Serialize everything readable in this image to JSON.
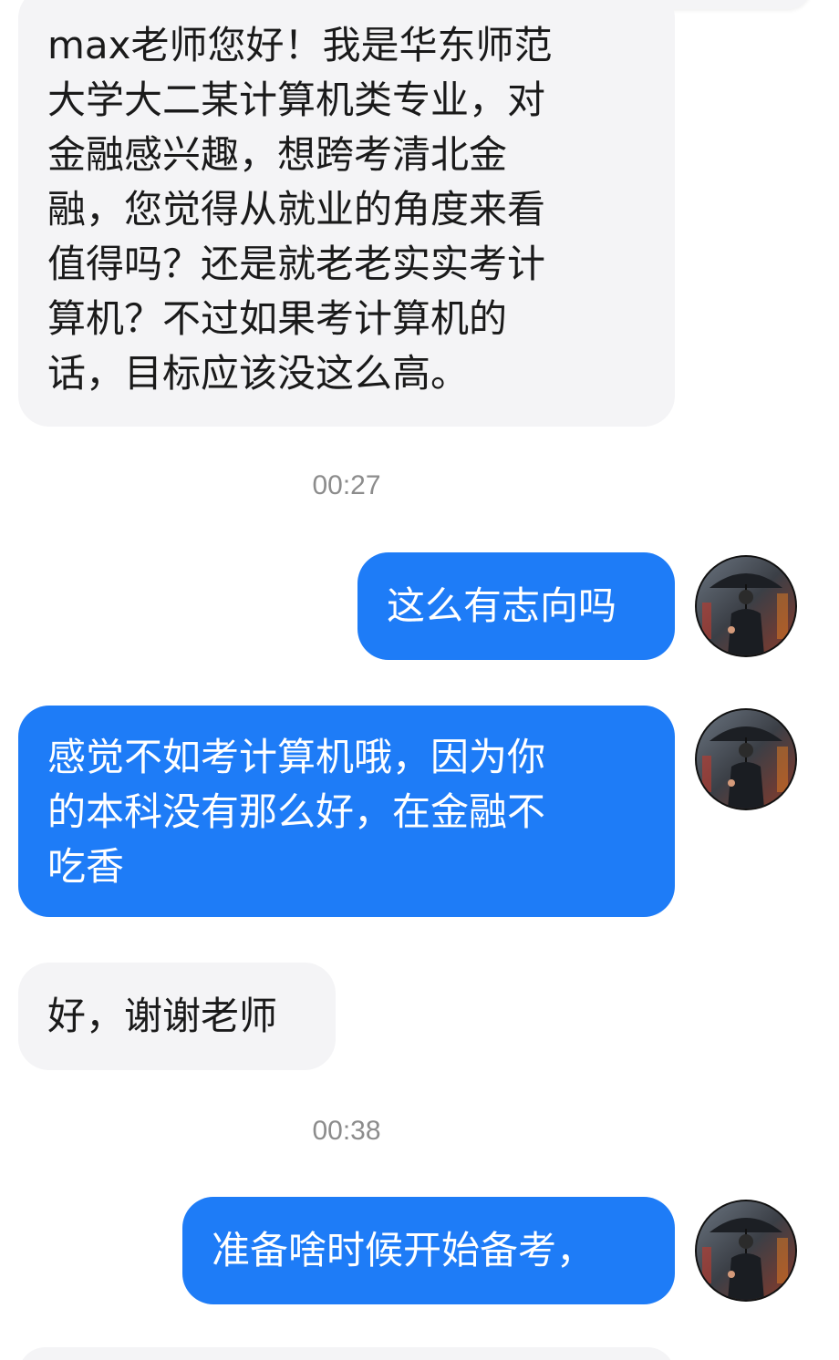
{
  "messages": [
    {
      "side": "in",
      "text": "max老师您好！我是华东师范\n大学大二某计算机类专业，对\n金融感兴趣，想跨考清北金\n融，您觉得从就业的角度来看\n值得吗？还是就老老实实考计\n算机？不过如果考计算机的\n话，目标应该没这么高。"
    },
    {
      "time": "00:27"
    },
    {
      "side": "out",
      "text": "这么有志向吗"
    },
    {
      "side": "out",
      "text": "感觉不如考计算机哦，因为你\n的本科没有那么好，在金融不\n吃香"
    },
    {
      "side": "in",
      "text": "好，谢谢老师"
    },
    {
      "time": "00:38"
    },
    {
      "side": "out",
      "text": "准备啥时候开始备考，"
    }
  ],
  "colors": {
    "outgoing_bubble": "#1e7cf7",
    "incoming_bubble": "#f4f4f6",
    "timestamp_text": "#8c8c8c"
  },
  "icons": {
    "avatar": "man-with-umbrella-avatar"
  }
}
